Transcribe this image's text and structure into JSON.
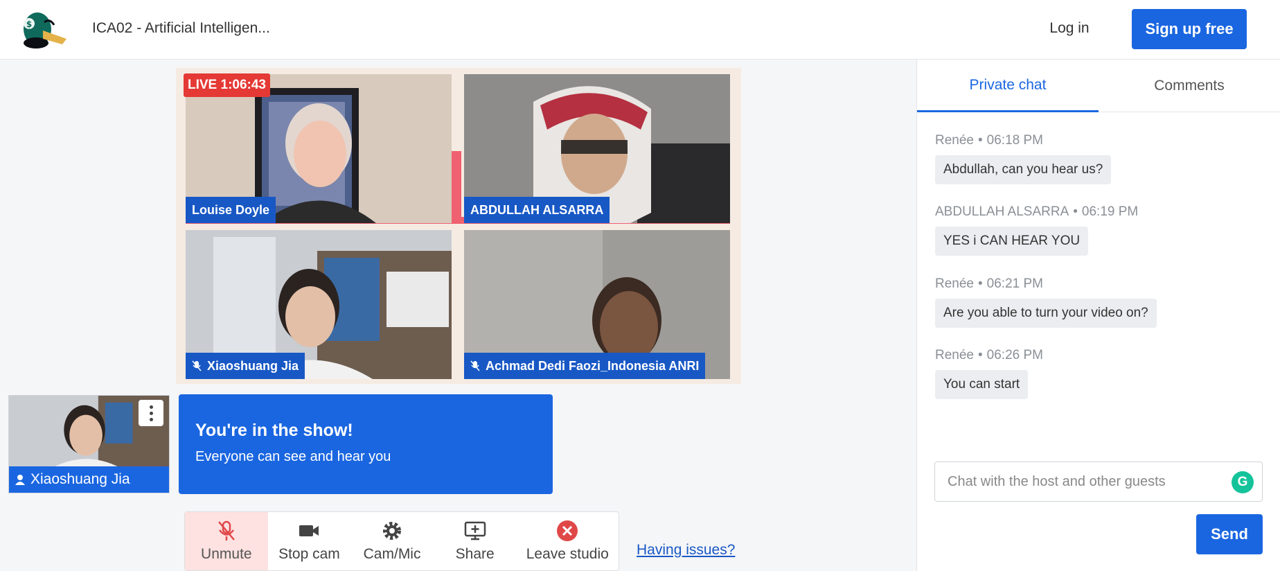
{
  "header": {
    "title": "ICA02 - Artificial Intelligen...",
    "login_label": "Log in",
    "signup_label": "Sign up free"
  },
  "stage": {
    "live_label": "LIVE 1:06:43",
    "participants": [
      {
        "name": "Louise Doyle",
        "muted": false
      },
      {
        "name": "ABDULLAH ALSARRA",
        "muted": false
      },
      {
        "name": "Xiaoshuang Jia",
        "muted": true
      },
      {
        "name": "Achmad Dedi Faozi_Indonesia ANRI",
        "muted": true
      }
    ]
  },
  "self_view": {
    "name": "Xiaoshuang Jia"
  },
  "banner": {
    "title": "You're in the show!",
    "subtitle": "Everyone can see and hear you"
  },
  "controls": {
    "unmute": "Unmute",
    "stop_cam": "Stop cam",
    "cam_mic": "Cam/Mic",
    "share": "Share",
    "leave": "Leave studio",
    "issues": "Having issues?"
  },
  "chat": {
    "tabs": [
      "Private chat",
      "Comments"
    ],
    "messages": [
      {
        "author": "Renée",
        "time": "06:18 PM",
        "text": "Abdullah, can you hear us?"
      },
      {
        "author": "ABDULLAH ALSARRA",
        "time": "06:19 PM",
        "text": "YES i CAN HEAR YOU"
      },
      {
        "author": "Renée",
        "time": "06:21 PM",
        "text": "Are you able to turn your video on?"
      },
      {
        "author": "Renée",
        "time": "06:26 PM",
        "text": "You can start"
      }
    ],
    "input_placeholder": "Chat with the host and other guests",
    "grammarly_glyph": "G",
    "send_label": "Send"
  },
  "colors": {
    "accent": "#1a66e0",
    "live": "#e53935",
    "nametag": "#1858c5"
  }
}
